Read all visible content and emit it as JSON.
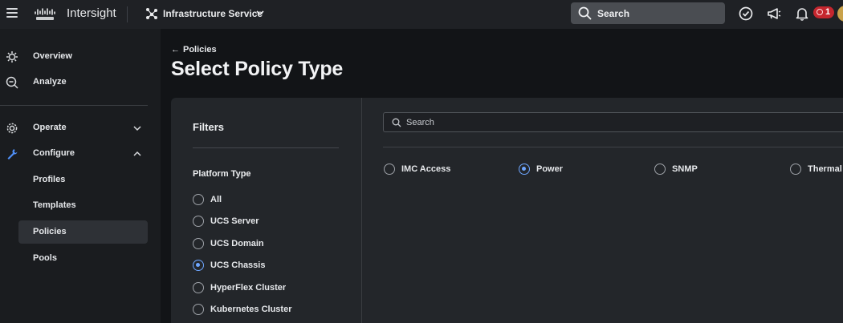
{
  "topbar": {
    "brand": "Intersight",
    "service": "Infrastructure Service",
    "search_label": "Search",
    "alert_count": "1",
    "icons": [
      "menu-icon",
      "cisco-logo-icon",
      "service-icon",
      "chevron-down-icon",
      "search-icon",
      "check-circle-icon",
      "megaphone-icon",
      "bell-icon",
      "alert-icon"
    ]
  },
  "sidebar": {
    "items": [
      {
        "label": "Overview",
        "icon": "overview-icon"
      },
      {
        "label": "Analyze",
        "icon": "analyze-icon"
      },
      {
        "label": "Operate",
        "icon": "gear-icon"
      },
      {
        "label": "Configure",
        "icon": "wrench-icon"
      }
    ],
    "configure_sub": [
      "Profiles",
      "Templates",
      "Policies",
      "Pools"
    ],
    "active_sub": "Policies"
  },
  "header": {
    "back_label": "Policies",
    "title": "Select Policy Type"
  },
  "filters": {
    "title": "Filters",
    "platform_type_title": "Platform Type",
    "options": [
      "All",
      "UCS Server",
      "UCS Domain",
      "UCS Chassis",
      "HyperFlex Cluster",
      "Kubernetes Cluster"
    ],
    "selected": "UCS Chassis"
  },
  "policies": {
    "search_placeholder": "Search",
    "options": [
      "IMC Access",
      "Power",
      "SNMP",
      "Thermal"
    ],
    "selected": "Power"
  },
  "colors": {
    "accent": "#6ea6ff",
    "badge": "#c4262e",
    "background": "#121417",
    "topbar": "#1f2125",
    "card": "#23262a"
  }
}
